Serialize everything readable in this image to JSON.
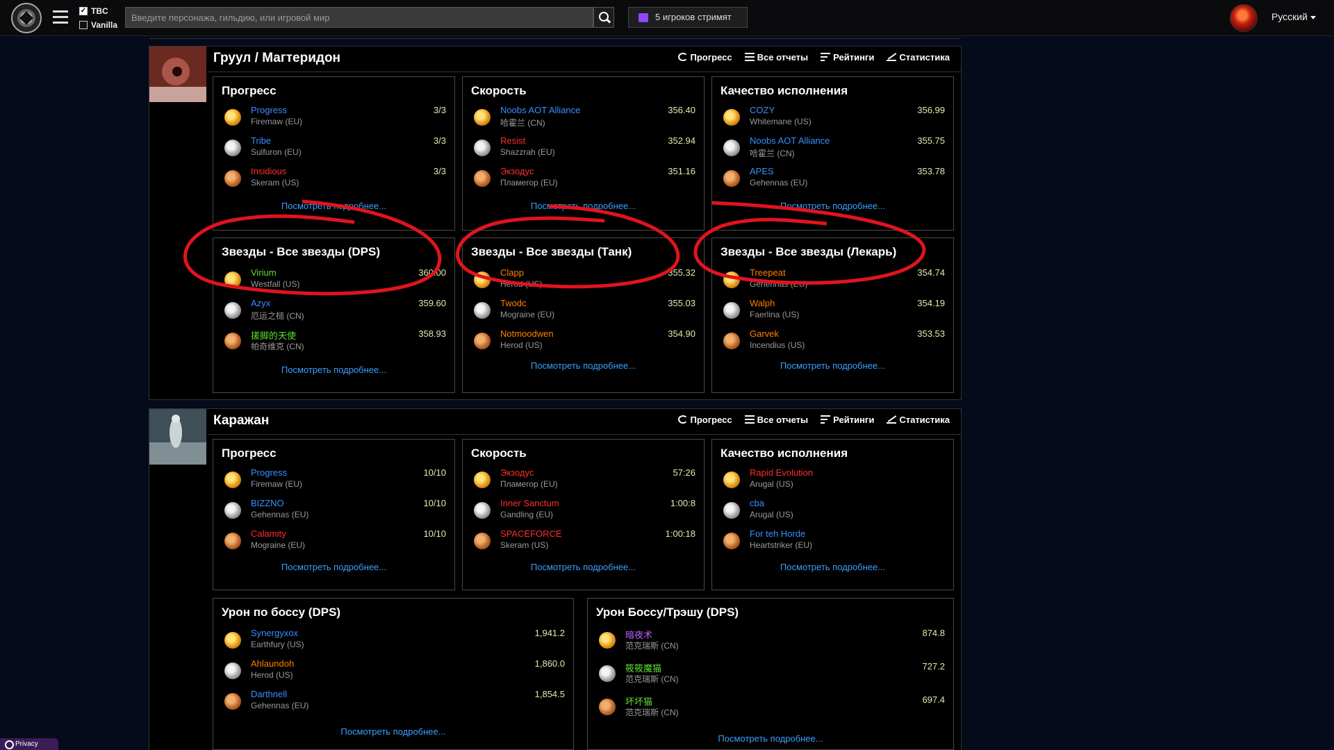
{
  "header": {
    "version_tbc": "TBC",
    "version_vanilla": "Vanilla",
    "search_placeholder": "Введите персонажа, гильдию, или игровой мир",
    "streaming": "5 игроков стримят",
    "language": "Русский"
  },
  "sections": [
    {
      "title": "Груул / Магтеридон",
      "links": {
        "progress": "Прогресс",
        "reports": "Все отчеты",
        "ratings": "Рейтинги",
        "stats": "Статистика"
      },
      "panels": [
        {
          "title": "Прогресс",
          "more": "Посмотреть подробнее...",
          "rows": [
            {
              "name": "Progress",
              "server": "Firemaw (EU)",
              "value": "3/3",
              "color": "rare"
            },
            {
              "name": "Tribe",
              "server": "Sulfuron (EU)",
              "value": "3/3",
              "color": "rare"
            },
            {
              "name": "Insidious",
              "server": "Skeram (US)",
              "value": "3/3",
              "color": "red"
            }
          ]
        },
        {
          "title": "Скорость",
          "more": "Посмотреть подробнее...",
          "rows": [
            {
              "name": "Noobs AOT Alliance",
              "server": "哈霍兰 (CN)",
              "value": "356.40",
              "color": "rare"
            },
            {
              "name": "Resist",
              "server": "Shazzrah (EU)",
              "value": "352.94",
              "color": "red"
            },
            {
              "name": "Экзодус",
              "server": "Пламегор (EU)",
              "value": "351.16",
              "color": "red"
            }
          ]
        },
        {
          "title": "Качество исполнения",
          "more": "Посмотреть подробнее...",
          "rows": [
            {
              "name": "COZY",
              "server": "Whitemane (US)",
              "value": "356.99",
              "color": "rare"
            },
            {
              "name": "Noobs AOT Alliance",
              "server": "哈霍兰 (CN)",
              "value": "355.75",
              "color": "rare"
            },
            {
              "name": "APES",
              "server": "Gehennas (EU)",
              "value": "353.78",
              "color": "rare"
            }
          ]
        },
        {
          "title": "Звезды - Все звезды (DPS)",
          "more": "Посмотреть подробнее...",
          "rows": [
            {
              "name": "Virium",
              "server": "Westfall (US)",
              "value": "360.00",
              "color": "green"
            },
            {
              "name": "Azyx",
              "server": "厄运之槌 (CN)",
              "value": "359.60",
              "color": "rare"
            },
            {
              "name": "搓脚的天使",
              "server": "帕奇维克 (CN)",
              "value": "358.93",
              "color": "green"
            }
          ]
        },
        {
          "title": "Звезды - Все звезды (Танк)",
          "more": "Посмотреть подробнее...",
          "rows": [
            {
              "name": "Clapp",
              "server": "Herod (US)",
              "value": "355.32",
              "color": "legendary"
            },
            {
              "name": "Twodc",
              "server": "Mograine (EU)",
              "value": "355.03",
              "color": "legendary"
            },
            {
              "name": "Notmoodwen",
              "server": "Herod (US)",
              "value": "354.90",
              "color": "legendary"
            }
          ]
        },
        {
          "title": "Звезды - Все звезды (Лекарь)",
          "more": "Посмотреть подробнее...",
          "rows": [
            {
              "name": "Treepeat",
              "server": "Gehennas (EU)",
              "value": "354.74",
              "color": "legendary"
            },
            {
              "name": "Walph",
              "server": "Faerlina (US)",
              "value": "354.19",
              "color": "legendary"
            },
            {
              "name": "Garvek",
              "server": "Incendius (US)",
              "value": "353.53",
              "color": "legendary"
            }
          ]
        }
      ]
    },
    {
      "title": "Каражан",
      "links": {
        "progress": "Прогресс",
        "reports": "Все отчеты",
        "ratings": "Рейтинги",
        "stats": "Статистика"
      },
      "panels": [
        {
          "title": "Прогресс",
          "more": "Посмотреть подробнее...",
          "rows": [
            {
              "name": "Progress",
              "server": "Firemaw (EU)",
              "value": "10/10",
              "color": "rare"
            },
            {
              "name": "BIZZNO",
              "server": "Gehennas (EU)",
              "value": "10/10",
              "color": "rare"
            },
            {
              "name": "Calamity",
              "server": "Mograine (EU)",
              "value": "10/10",
              "color": "red"
            }
          ]
        },
        {
          "title": "Скорость",
          "more": "Посмотреть подробнее...",
          "rows": [
            {
              "name": "Экзодус",
              "server": "Пламегор (EU)",
              "value": "57:26",
              "color": "red"
            },
            {
              "name": "Inner Sanctum",
              "server": "Gandling (EU)",
              "value": "1:00:8",
              "color": "red"
            },
            {
              "name": "SPACEFORCE",
              "server": "Skeram (US)",
              "value": "1:00:18",
              "color": "red"
            }
          ]
        },
        {
          "title": "Качество исполнения",
          "more": "Посмотреть подробнее...",
          "rows": [
            {
              "name": "Rapid Evolution",
              "server": "Arugal (US)",
              "value": "",
              "color": "red"
            },
            {
              "name": "cba",
              "server": "Arugal (US)",
              "value": "",
              "color": "rare"
            },
            {
              "name": "For teh Horde",
              "server": "Heartstriker (EU)",
              "value": "",
              "color": "rare"
            }
          ]
        },
        {
          "title": "Урон по боссу (DPS)",
          "more": "Посмотреть подробнее...",
          "rows": [
            {
              "name": "Synergyxox",
              "server": "Earthfury (US)",
              "value": "1,941.2",
              "color": "rare"
            },
            {
              "name": "Ahlaundoh",
              "server": "Herod (US)",
              "value": "1,860.0",
              "color": "legendary"
            },
            {
              "name": "Darthnell",
              "server": "Gehennas (EU)",
              "value": "1,854.5",
              "color": "rare"
            }
          ]
        },
        {
          "title": "Урон Боссу/Трэшу (DPS)",
          "more": "Посмотреть подробнее...",
          "rows": [
            {
              "name": "暗夜术",
              "server": "范克瑞斯 (CN)",
              "value": "874.8",
              "color": "epic"
            },
            {
              "name": "筱筱魔猫",
              "server": "范克瑞斯 (CN)",
              "value": "727.2",
              "color": "green"
            },
            {
              "name": "坏坏猫",
              "server": "范克瑞斯 (CN)",
              "value": "697.4",
              "color": "green"
            }
          ]
        }
      ]
    }
  ],
  "footer": {
    "privacy": "Privacy"
  },
  "colors": {
    "legendary": "#ff8000",
    "epic": "#c060ff",
    "rare": "#3a8fff",
    "red": "#ff2d2d",
    "green": "#5fe030",
    "link": "#3aa0ff",
    "annotation": "#e0141e"
  }
}
